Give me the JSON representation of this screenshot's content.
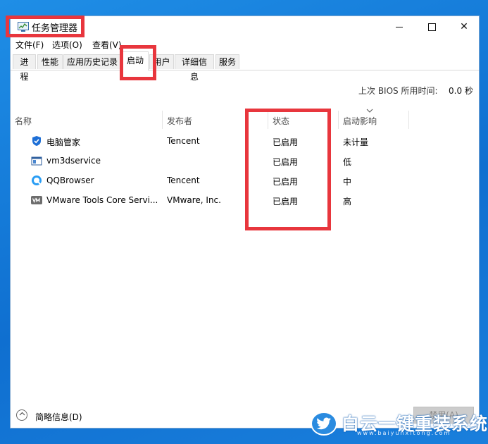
{
  "window": {
    "title": "任务管理器",
    "controls": {
      "minimize": "",
      "maximize": "",
      "close": "✕"
    }
  },
  "menu": [
    "文件(F)",
    "选项(O)",
    "查看(V)"
  ],
  "tabs": [
    {
      "label": "进程",
      "active": false
    },
    {
      "label": "性能",
      "active": false
    },
    {
      "label": "应用历史记录",
      "active": false
    },
    {
      "label": "启动",
      "active": true
    },
    {
      "label": "用户",
      "active": false
    },
    {
      "label": "详细信息",
      "active": false
    },
    {
      "label": "服务",
      "active": false
    }
  ],
  "bios": {
    "label": "上次 BIOS 所用时间:",
    "value": "0.0 秒"
  },
  "columns": {
    "name": "名称",
    "publisher": "发布者",
    "status": "状态",
    "impact": "启动影响"
  },
  "rows": [
    {
      "name": "电脑管家",
      "publisher": "Tencent",
      "status": "已启用",
      "impact": "未计量",
      "icon": "shield-icon"
    },
    {
      "name": "vm3dservice",
      "publisher": "",
      "status": "已启用",
      "impact": "低",
      "icon": "window-icon"
    },
    {
      "name": "QQBrowser",
      "publisher": "Tencent",
      "status": "已启用",
      "impact": "中",
      "icon": "browser-icon"
    },
    {
      "name": "VMware Tools Core Servi...",
      "publisher": "VMware, Inc.",
      "status": "已启用",
      "impact": "高",
      "icon": "vm-icon"
    }
  ],
  "footer": {
    "fewer_details": "简略信息(D)",
    "disable_button": "禁用(A)"
  },
  "watermark": {
    "text": "白云一键重装系统",
    "url": "www.baiyunxitong.com"
  },
  "colors": {
    "highlight": "#e8363d",
    "desktop": "#1a7fdc"
  }
}
